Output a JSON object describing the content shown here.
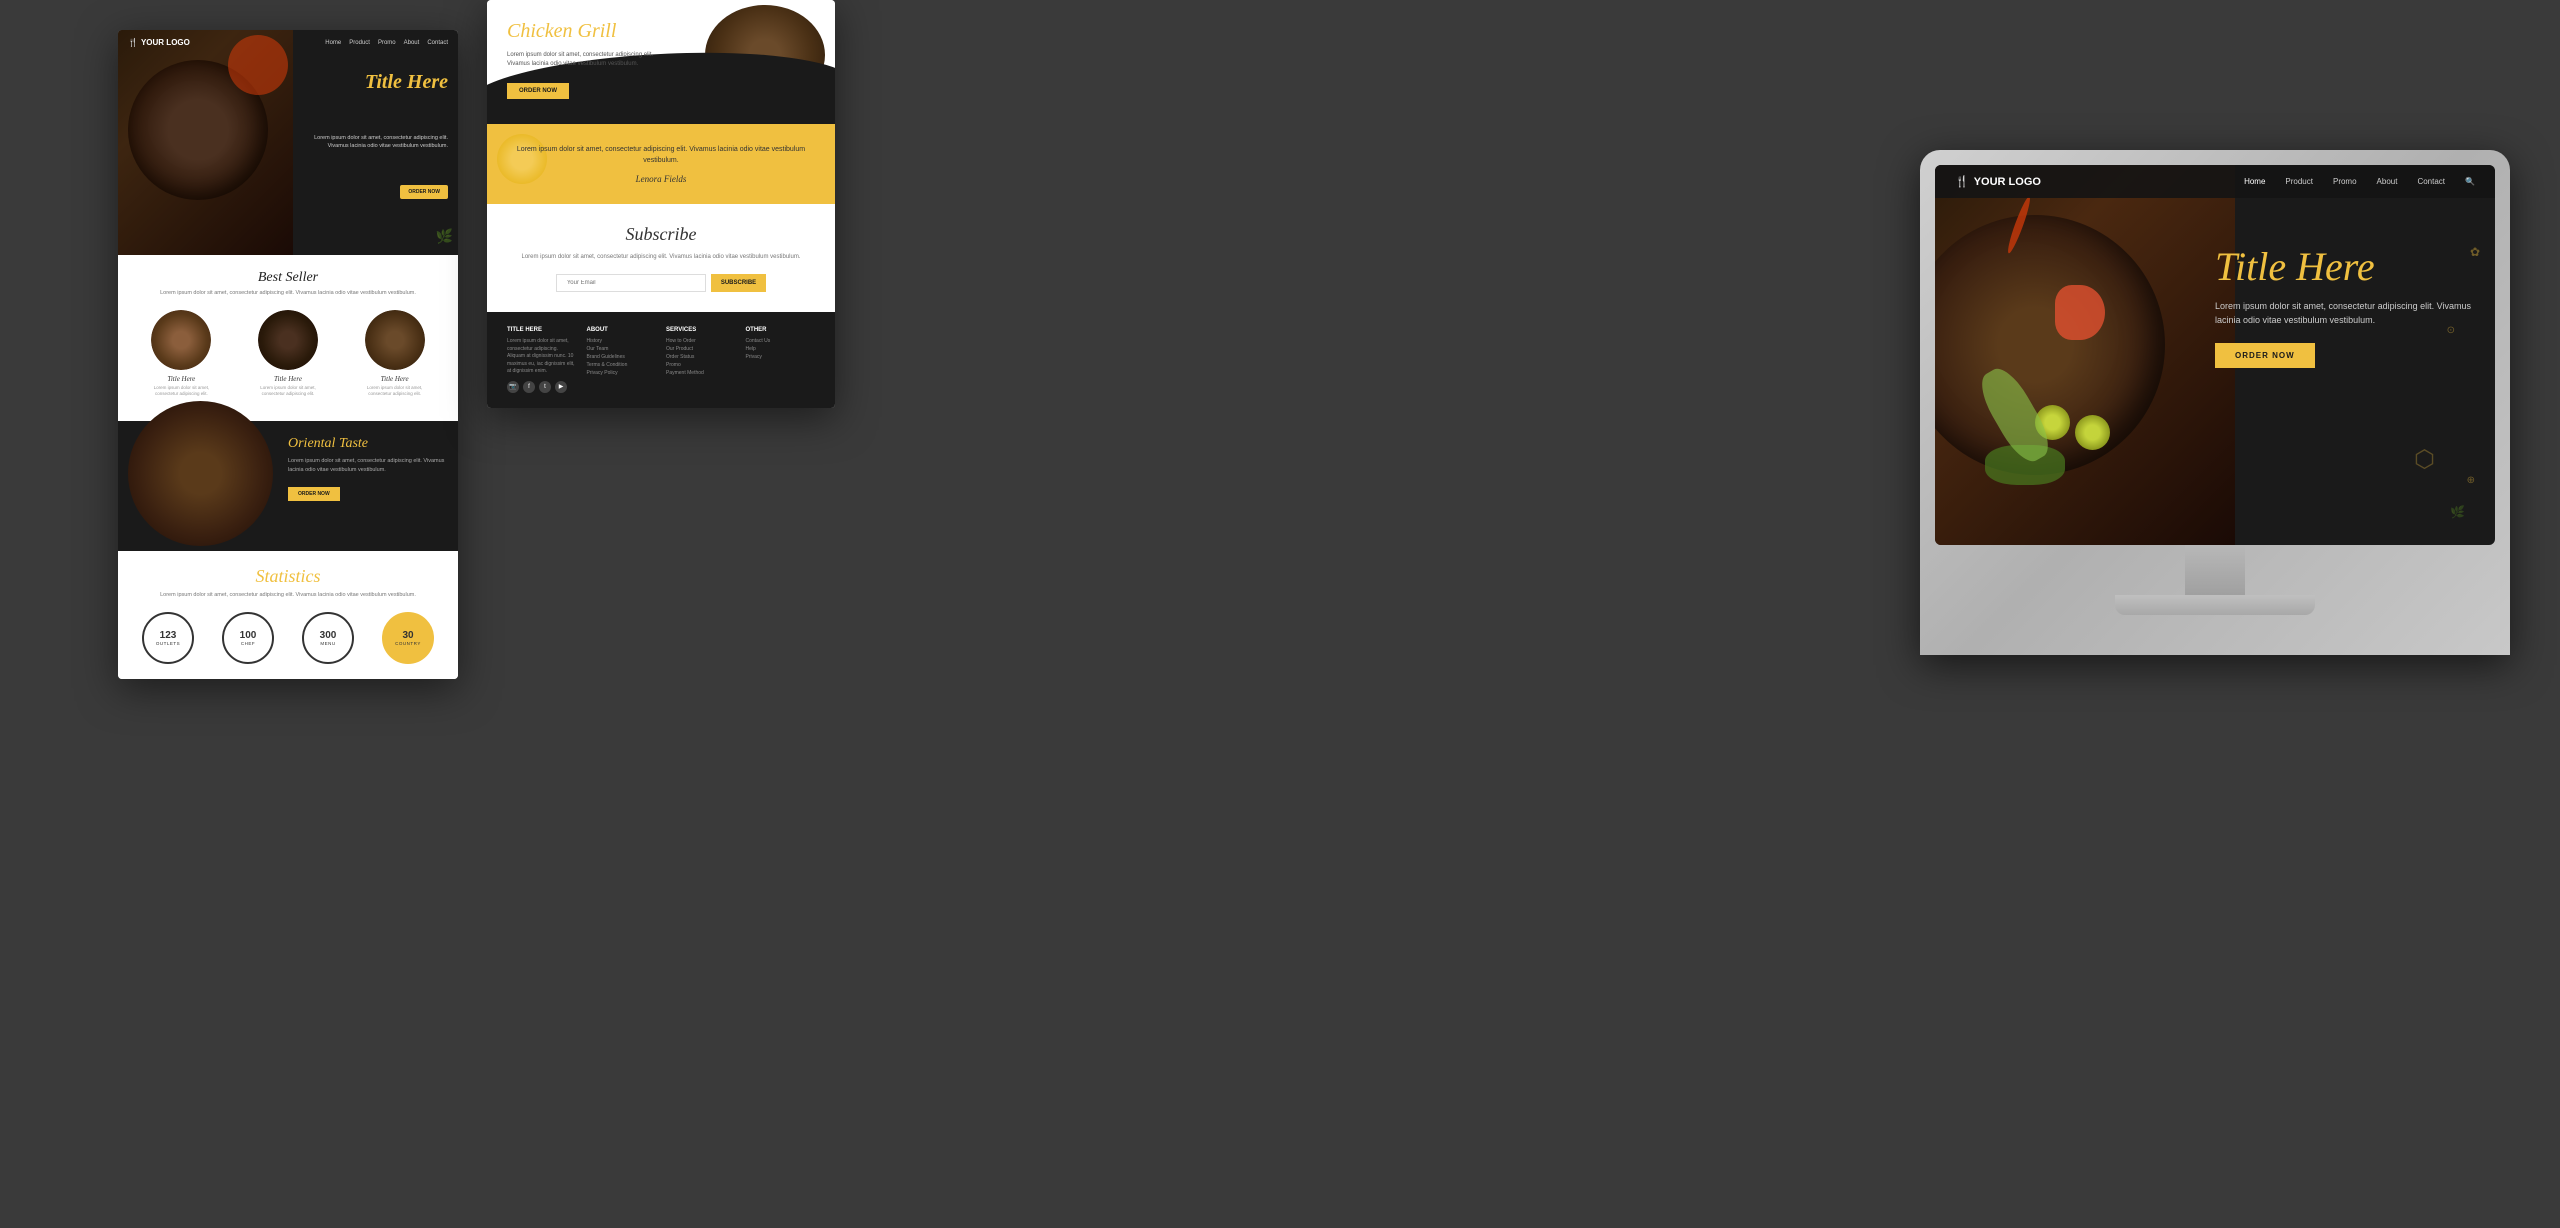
{
  "background_color": "#3a3a3a",
  "left_mockup": {
    "nav": {
      "logo": "YOUR LOGO",
      "links": [
        "Home",
        "Product",
        "Promo",
        "About",
        "Contact"
      ]
    },
    "hero": {
      "title": "Title Here",
      "description": "Lorem ipsum dolor sit amet, consectetur adipiscing elit. Vivamus lacinia odio vitae vestibulum vestibulum.",
      "button": "ORDER NOW",
      "decorations": [
        "🌿",
        "🧅",
        "🌶"
      ]
    },
    "bestseller": {
      "title": "Best Seller",
      "description": "Lorem ipsum dolor sit amet, consectetur adipiscing elit. Vivamus lacinia odio vitae vestibulum vestibulum.",
      "items": [
        {
          "title": "Title Here",
          "description": "Lorem ipsum dolor sit amet, consectetur adipiscing elit."
        },
        {
          "title": "Title Here",
          "description": "Lorem ipsum dolor sit amet, consectetur adipiscing elit."
        },
        {
          "title": "Title Here",
          "description": "Lorem ipsum dolor sit amet, consectetur adipiscing elit."
        }
      ]
    },
    "oriental": {
      "title": "Oriental Taste",
      "description": "Lorem ipsum dolor sit amet, consectetur adipiscing elit. Vivamus lacinia odio vitae vestibulum vestibulum.",
      "button": "ORDER NOW"
    },
    "statistics": {
      "title": "Statistics",
      "description": "Lorem ipsum dolor sit amet, consectetur adipiscing elit. Vivamus lacinia odio vitae vestibulum vestibulum.",
      "stats": [
        {
          "number": "123",
          "label": "OUTLETS"
        },
        {
          "number": "100",
          "label": "CHEF"
        },
        {
          "number": "300",
          "label": "MENU"
        },
        {
          "number": "30",
          "label": "COUNTRY"
        }
      ]
    }
  },
  "mid_mockup": {
    "hero": {
      "title": "Chicken Grill",
      "description": "Lorem ipsum dolor sit amet, consectetur adipiscing elit. Vivamus lacinia odio vitae vestibulum vestibulum.",
      "button": "ORDER NOW"
    },
    "testimonial": {
      "text": "Lorem ipsum dolor sit amet, consectetur adipiscing elit. Vivamus lacinia odio vitae vestibulum vestibulum.",
      "author": "Lenora Fields"
    },
    "subscribe": {
      "title": "Subscribe",
      "description": "Lorem ipsum dolor sit amet, consectetur adipiscing elit. Vivamus lacinia odio vitae vestibulum vestibulum.",
      "input_placeholder": "Your Email",
      "button": "SUBSCRIBE"
    },
    "footer": {
      "columns": [
        {
          "title": "TITLE HERE",
          "content": "Lorem ipsum dolor sit amet, consectetur adipiscing. Aliquam at dignissim nunc. 10 maximus eu, iac dignissim elit, at dignissim enim.",
          "social": true
        },
        {
          "title": "ABOUT",
          "links": [
            "History",
            "Our Team",
            "Brand Guidelines",
            "Terms & Condition",
            "Privacy Policy"
          ]
        },
        {
          "title": "SERVICES",
          "links": [
            "How to Order",
            "Our Product",
            "Order Status",
            "Promo",
            "Payment Method"
          ]
        },
        {
          "title": "OTHER",
          "links": [
            "Contact Us",
            "Help",
            "Privacy"
          ]
        }
      ]
    }
  },
  "right_mockup": {
    "nav": {
      "logo": "YOUR LOGO",
      "links": [
        "Home",
        "Product",
        "Promo",
        "About",
        "Contact"
      ]
    },
    "hero": {
      "title": "Title Here",
      "description": "Lorem ipsum dolor sit amet, consectetur adipiscing elit. Vivamus lacinia odio vitae vestibulum vestibulum.",
      "button": "ORDER NOW"
    }
  },
  "colors": {
    "accent": "#f0c040",
    "dark": "#1a1a1a",
    "white": "#ffffff",
    "bg": "#3a3a3a"
  }
}
